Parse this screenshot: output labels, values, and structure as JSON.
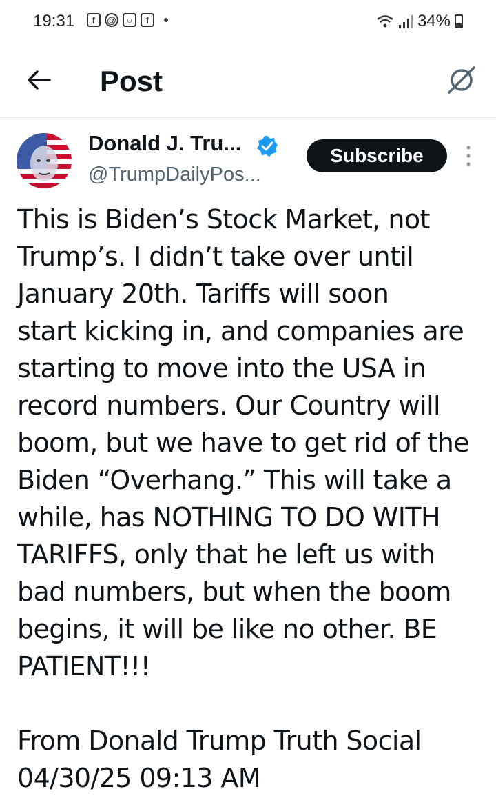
{
  "status_bar": {
    "time": "19:31",
    "battery": "34%",
    "battery_level": 0.34,
    "notification_icons": [
      "facebook-icon",
      "threads-icon",
      "instagram-icon",
      "facebook-icon"
    ]
  },
  "header": {
    "title": "Post",
    "back_icon": "arrow-left-icon",
    "grok_icon": "grok-icon"
  },
  "post": {
    "author_name": "Donald J. Tru...",
    "author_handle": "@TrumpDailyPos...",
    "verified": true,
    "subscribe_label": "Subscribe",
    "body": "This is Biden’s Stock Market, not\nTrump’s. I didn’t take over until\nJanuary 20th. Tariffs will soon\nstart kicking in, and companies are\nstarting to move into the USA in\nrecord numbers. Our Country will\nboom, but we have to get rid of the\nBiden “Overhang.” This will take a\nwhile, has NOTHING TO DO WITH\nTARIFFS, only that he left us with\nbad numbers, but when the boom\nbegins, it will be like no other. BE\nPATIENT!!!\n\nFrom Donald Trump Truth Social\n04/30/25 09:13 AM"
  },
  "colors": {
    "text": "#0f1419",
    "secondary_text": "#536471",
    "verified": "#1d9bf0",
    "button_bg": "#0f1419"
  }
}
